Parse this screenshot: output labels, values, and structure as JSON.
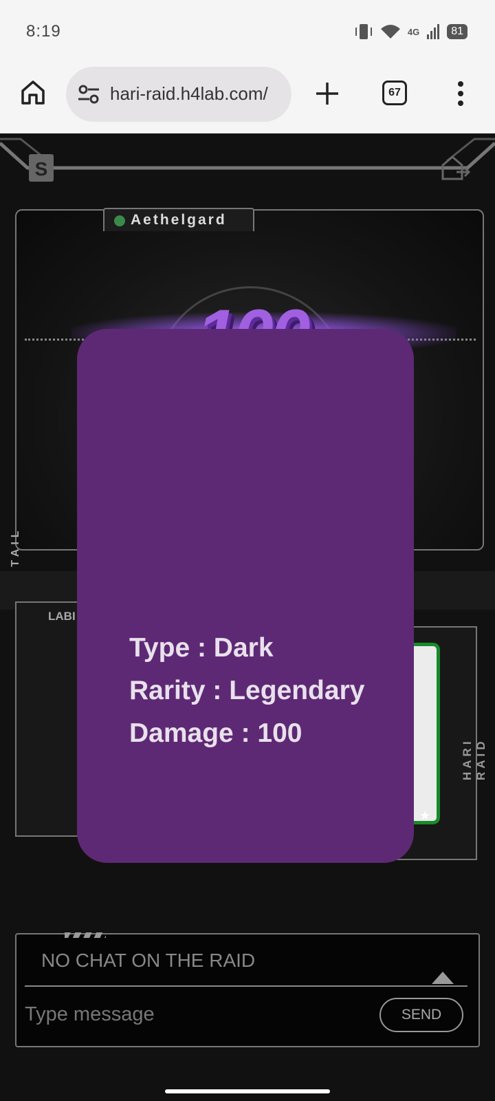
{
  "status_bar": {
    "time": "8:19",
    "network": "4G",
    "battery": "81"
  },
  "browser": {
    "url": "hari-raid.h4lab.com/",
    "tab_count": "67"
  },
  "raid": {
    "boss_name": "Aethelgard",
    "damage_display": "100",
    "side_label_left": "DETAIL",
    "side_label_right": "HARI RAID",
    "panel_label": "LABI"
  },
  "popup": {
    "type_line": "Type : Dark",
    "rarity_line": "Rarity : Legendary",
    "damage_line": "Damage : 100"
  },
  "chat": {
    "empty_message": "NO CHAT ON THE RAID",
    "input_placeholder": "Type message",
    "send_label": "SEND"
  },
  "colors": {
    "popup_bg": "#5e2974",
    "damage_purple": "#a060e0",
    "online_green": "#3a8a4a",
    "hero_frame_green": "#1a8a2a"
  }
}
